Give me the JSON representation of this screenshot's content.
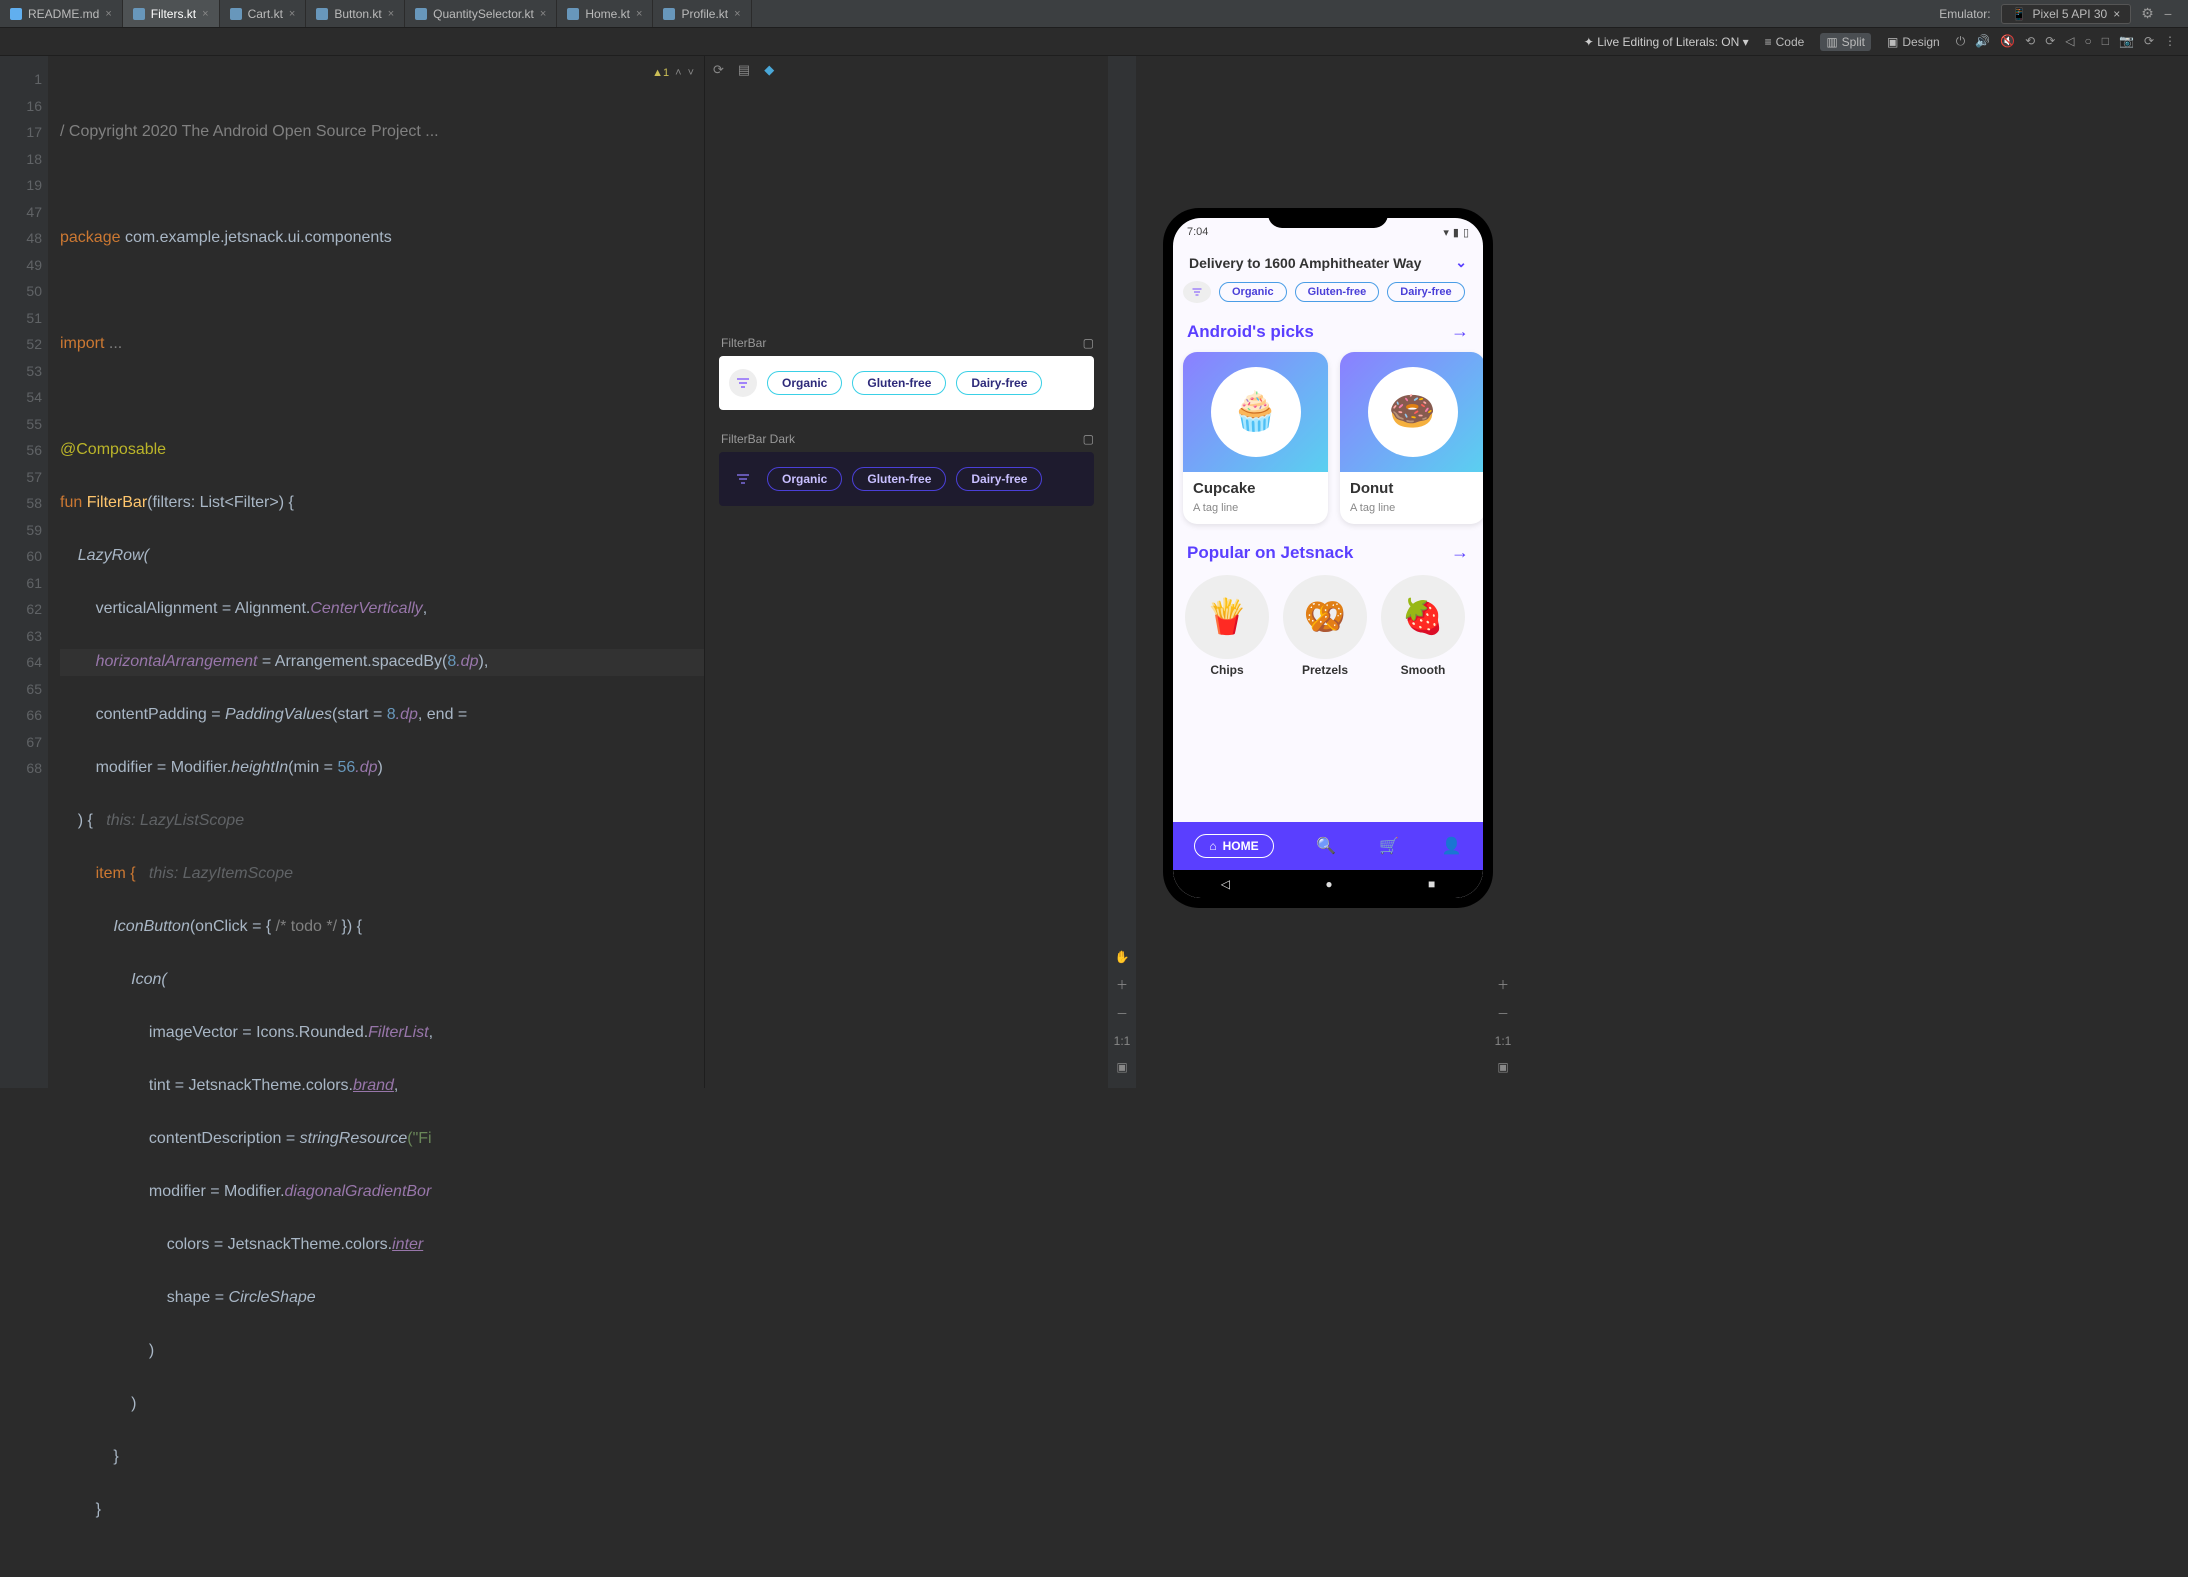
{
  "top": {
    "tabs": [
      "README.md",
      "Filters.kt",
      "Cart.kt",
      "Button.kt",
      "QuantitySelector.kt",
      "Home.kt",
      "Profile.kt"
    ],
    "active_tab": 1,
    "emulator_label": "Emulator:",
    "device": "Pixel 5 API 30"
  },
  "subbar": {
    "live_edit": "Live Editing of Literals: ON",
    "view_code": "Code",
    "view_split": "Split",
    "view_design": "Design"
  },
  "inspections": {
    "warn_badge": "1"
  },
  "gutter": [
    "1",
    "16",
    "17",
    "18",
    "19",
    "47",
    "48",
    "49",
    "50",
    "51",
    "52",
    "53",
    "54",
    "55",
    "56",
    "57",
    "58",
    "59",
    "60",
    "61",
    "62",
    "63",
    "64",
    "65",
    "66",
    "67",
    "68"
  ],
  "code": {
    "l1": "/ Copyright 2020 The Android Open Source Project ...",
    "l3_pkg": "package",
    "l3_name": " com.example.jetsnack.ui.components",
    "l5_imp": "import",
    "l5_dots": " ...",
    "l7": "@Composable",
    "l8a": "fun ",
    "l8b": "FilterBar",
    "l8c": "(filters: List<Filter>) {",
    "l9": "    LazyRow(",
    "l10a": "        verticalAlignment = Alignment.",
    "l10b": "CenterVertically",
    "l10c": ",",
    "l11a": "        horizontalArrangement",
    "l11b": " = Arrangement.spacedBy(",
    "l11c": "8",
    "l11d": ".dp",
    "l11e": "),",
    "l12a": "        contentPadding = ",
    "l12b": "PaddingValues",
    "l12c": "(start = ",
    "l12d": "8",
    "l12e": ".dp",
    "l12f": ", end = ",
    "l13a": "        modifier = Modifier.",
    "l13b": "heightIn",
    "l13c": "(min = ",
    "l13d": "56",
    "l13e": ".dp",
    "l13f": ")",
    "l14a": "    ) {",
    "l14h": "   this: LazyListScope",
    "l15a": "        item {",
    "l15h": "   this: LazyItemScope",
    "l16a": "            IconButton",
    "l16b": "(onClick = { ",
    "l16c": "/* todo */",
    "l16d": " }) {",
    "l17": "                Icon(",
    "l18a": "                    imageVector = Icons.Rounded.",
    "l18b": "FilterList",
    "l18c": ",",
    "l19a": "                    tint = JetsnackTheme.colors.",
    "l19b": "brand",
    "l19c": ",",
    "l20a": "                    contentDescription = ",
    "l20b": "stringResource",
    "l20c": "(\"Fi",
    "l21a": "                    modifier = Modifier.",
    "l21b": "diagonalGradientBor",
    "l22a": "                        colors = JetsnackTheme.colors.",
    "l22b": "inter",
    "l23a": "                        shape = ",
    "l23b": "CircleShape",
    "l24": "                    )",
    "l25": "                )",
    "l26": "            }",
    "l27": "        }"
  },
  "preview": {
    "label_light": "FilterBar",
    "label_dark": "FilterBar Dark",
    "chips": [
      "Organic",
      "Gluten-free",
      "Dairy-free"
    ]
  },
  "pv_side": {
    "fit": "1:1"
  },
  "phone": {
    "time": "7:04",
    "delivery": "Delivery to 1600 Amphitheater Way",
    "filters": [
      "Organic",
      "Gluten-free",
      "Dairy-free"
    ],
    "section1": "Android's picks",
    "cards": [
      {
        "title": "Cupcake",
        "tag": "A tag line",
        "emoji": "🧁"
      },
      {
        "title": "Donut",
        "tag": "A tag line",
        "emoji": "🍩"
      }
    ],
    "section2": "Popular on Jetsnack",
    "rounds": [
      {
        "label": "Chips",
        "emoji": "🍟"
      },
      {
        "label": "Pretzels",
        "emoji": "🥨"
      },
      {
        "label": "Smooth",
        "emoji": "🍓"
      }
    ],
    "nav_home": "HOME"
  },
  "emu_side": {
    "fit": "1:1"
  }
}
